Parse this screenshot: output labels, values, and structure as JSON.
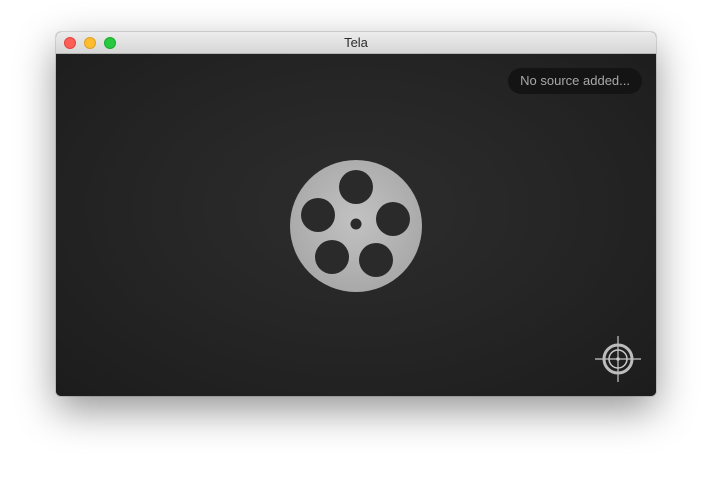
{
  "window": {
    "title": "Tela"
  },
  "titlebar": {
    "buttons": [
      {
        "name": "close",
        "color": "#fd5f57"
      },
      {
        "name": "minimize",
        "color": "#febc2e"
      },
      {
        "name": "zoom",
        "color": "#28c840"
      }
    ]
  },
  "main": {
    "source_status": "No source added...",
    "placeholder_icon": "film-reel-icon",
    "locate_icon": "crosshair-icon"
  },
  "colors": {
    "background": "#262626",
    "pill_background": "#141414",
    "pill_text": "#a8a8a8",
    "icon": "#b4b4b4"
  }
}
